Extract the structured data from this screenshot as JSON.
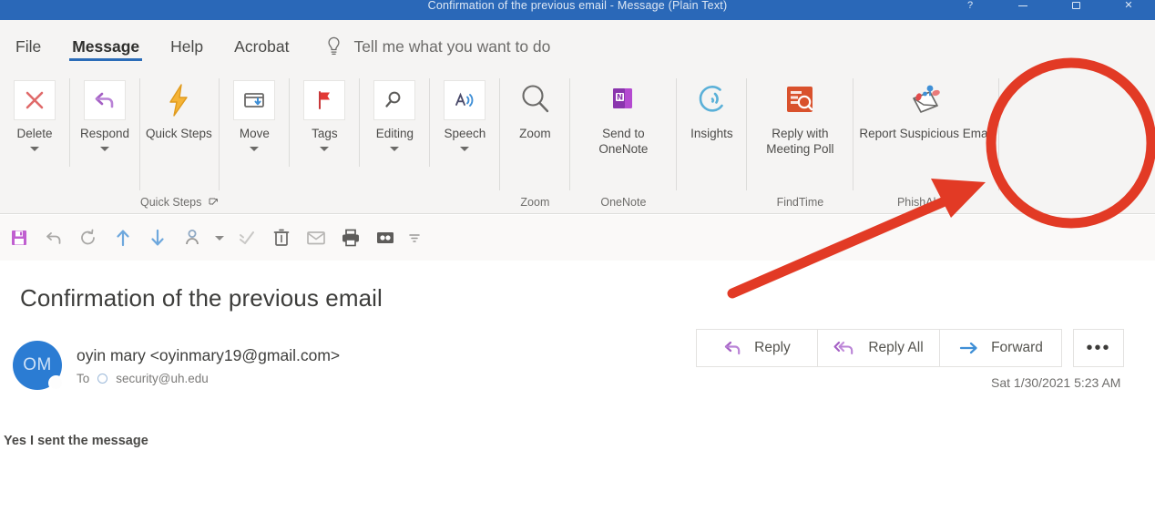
{
  "window": {
    "title": "Confirmation of the previous email  -  Message (Plain Text)",
    "controls": {
      "help_label": "?",
      "minimize_label": "minimize-icon",
      "restore_label": "restore-icon",
      "close_label": "close-icon"
    }
  },
  "tabs": [
    {
      "label": "File",
      "active": false
    },
    {
      "label": "Message",
      "active": true
    },
    {
      "label": "Help",
      "active": false
    },
    {
      "label": "Acrobat",
      "active": false
    }
  ],
  "tellme": {
    "label": "Tell me what you want to do",
    "icon": "lightbulb-icon"
  },
  "ribbon": {
    "groups": [
      {
        "label": "",
        "items": [
          {
            "label": "Delete",
            "icon": "delete-x-icon",
            "caret": true
          },
          {
            "label": "Respond",
            "icon": "respond-reply-icon",
            "caret": true
          }
        ]
      },
      {
        "label": "Quick Steps",
        "launcher": "dialog-launcher-icon",
        "items": [
          {
            "label": "Quick Steps",
            "icon": "lightning-bolt-icon",
            "caret": true
          }
        ]
      },
      {
        "label": "",
        "items": [
          {
            "label": "Move",
            "icon": "move-folder-icon",
            "caret": true
          },
          {
            "label": "Tags",
            "icon": "red-flag-icon",
            "caret": true
          },
          {
            "label": "Editing",
            "icon": "magnifier-icon",
            "caret": true
          },
          {
            "label": "Speech",
            "icon": "read-aloud-icon",
            "caret": true
          }
        ]
      },
      {
        "label": "Zoom",
        "items": [
          {
            "label": "Zoom",
            "icon": "zoom-magnifier-icon",
            "caret": false
          }
        ]
      },
      {
        "label": "OneNote",
        "items": [
          {
            "label": "Send to OneNote",
            "icon": "onenote-icon",
            "caret": false
          }
        ]
      },
      {
        "label": "",
        "items": [
          {
            "label": "Insights",
            "icon": "insights-icon",
            "caret": false
          }
        ]
      },
      {
        "label": "FindTime",
        "items": [
          {
            "label": "Reply with Meeting Poll",
            "icon": "meeting-poll-icon",
            "caret": false
          }
        ]
      },
      {
        "label": "PhishAlarm",
        "items": [
          {
            "label": "Report Suspicious Email",
            "icon": "report-phish-icon",
            "caret": false
          }
        ]
      }
    ]
  },
  "quick_access": [
    {
      "icon": "save-icon"
    },
    {
      "icon": "undo-icon"
    },
    {
      "icon": "redo-icon"
    },
    {
      "icon": "previous-item-up-icon"
    },
    {
      "icon": "next-item-down-icon"
    },
    {
      "icon": "contact-person-icon"
    },
    {
      "icon": "qat-dropdown-caret-icon"
    },
    {
      "icon": "mark-unread-icon"
    },
    {
      "icon": "delete-trash-icon"
    },
    {
      "icon": "envelope-icon"
    },
    {
      "icon": "print-icon"
    },
    {
      "icon": "address-book-icon"
    },
    {
      "icon": "customize-qat-caret-icon"
    }
  ],
  "message": {
    "subject": "Confirmation of the previous email",
    "avatar_initials": "OM",
    "sender": "oyin mary  <oyinmary19@gmail.com>",
    "to_label": "To",
    "to_recipient": "security@uh.edu",
    "timestamp": "Sat 1/30/2021 5:23 AM",
    "body": "Yes I sent the message"
  },
  "actions": [
    {
      "label": "Reply",
      "icon": "reply-arrow-icon"
    },
    {
      "label": "Reply All",
      "icon": "reply-all-arrow-icon"
    },
    {
      "label": "Forward",
      "icon": "forward-arrow-icon"
    }
  ],
  "more_actions_label": "•••",
  "annotation": {
    "circle_target": "Report Suspicious Email",
    "color": "#e23a25"
  },
  "colors": {
    "titlebar": "#2a68b8",
    "ribbon_bg": "#f5f4f3",
    "accent_red": "#e23a25",
    "avatar_blue": "#2b7cd3",
    "tab_underline": "#2b6cb8"
  }
}
